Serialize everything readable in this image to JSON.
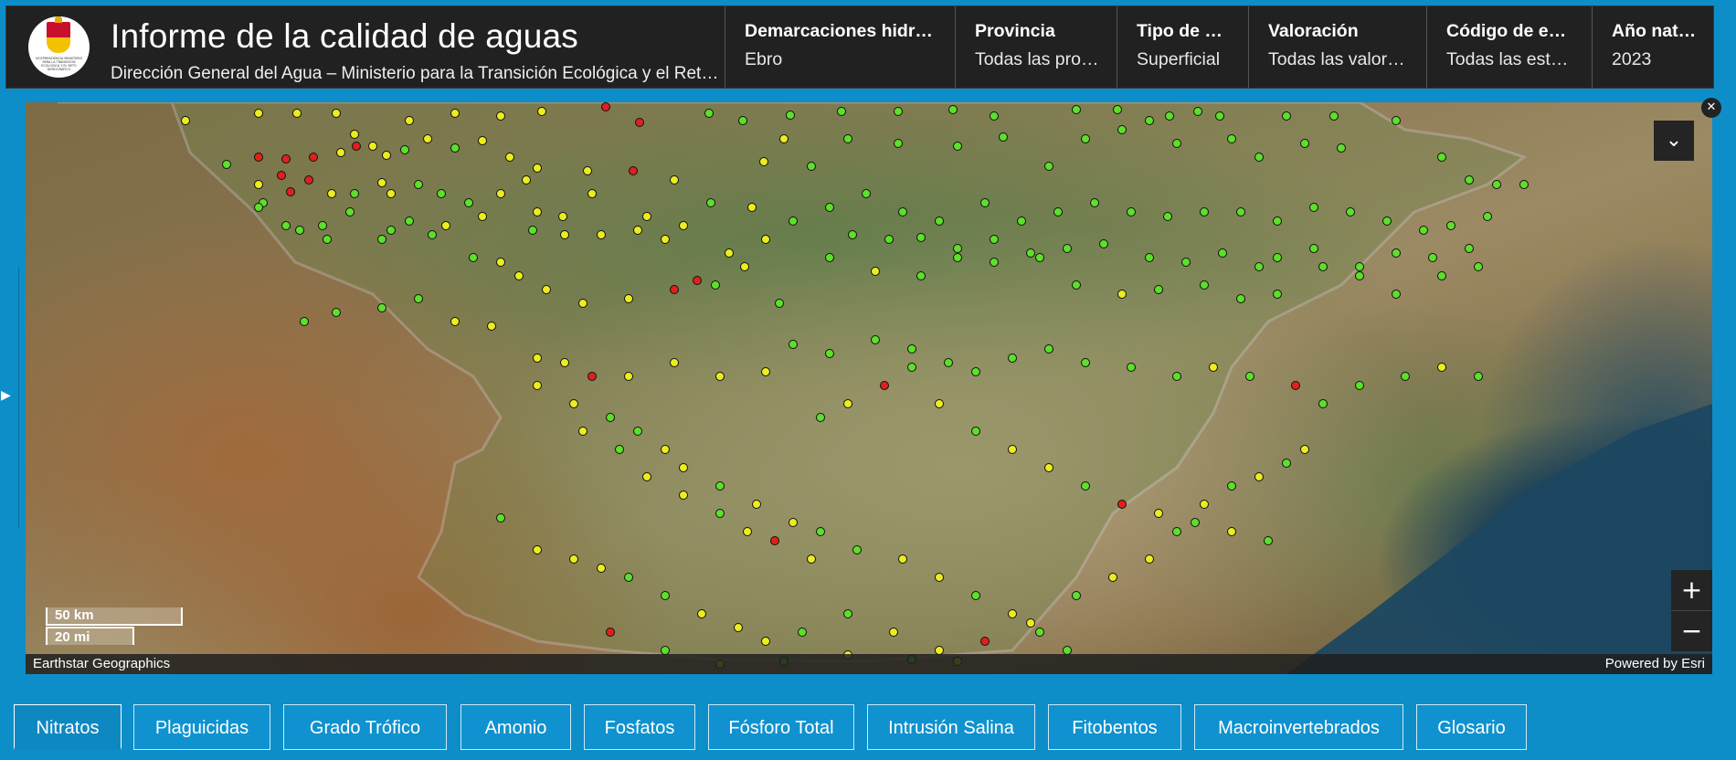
{
  "header": {
    "title": "Informe de la calidad de aguas",
    "subtitle": "Dirección General del Agua – Ministerio para la Transición Ecológica y el Reto Demográfico",
    "logo_text": "VICEPRESIDENCIA MINISTERIO PARA LA TRANSICIÓN ECOLÓGICA Y EL RETO DEMOGRÁFICO",
    "filters": [
      {
        "label": "Demarcaciones hidrográficas",
        "value": "Ebro"
      },
      {
        "label": "Provincia",
        "value": "Todas las provincias"
      },
      {
        "label": "Tipo de agua",
        "value": "Superficial"
      },
      {
        "label": "Valoración",
        "value": "Todas las valoraciones"
      },
      {
        "label": "Código de estación",
        "value": "Todas las estaciones"
      },
      {
        "label": "Año natural",
        "value": "2023"
      }
    ]
  },
  "map": {
    "attribution_left": "Earthstar Geographics",
    "attribution_right": "Powered by Esri",
    "scale_km": "50 km",
    "scale_mi": "20 mi",
    "zoom_in": "+",
    "zoom_out": "−",
    "point_colors": {
      "good": "#5ce02a",
      "moderate": "#ecec1f",
      "bad": "#e0201b"
    }
  },
  "tabs": [
    {
      "label": "Nitratos",
      "active": true
    },
    {
      "label": "Plaguicidas"
    },
    {
      "label": "Grado Trófico"
    },
    {
      "label": "Amonio"
    },
    {
      "label": "Fosfatos"
    },
    {
      "label": "Fósforo Total"
    },
    {
      "label": "Intrusión Salina"
    },
    {
      "label": "Fitobentos"
    },
    {
      "label": "Macroinvertebrados"
    },
    {
      "label": "Glosario"
    }
  ]
}
